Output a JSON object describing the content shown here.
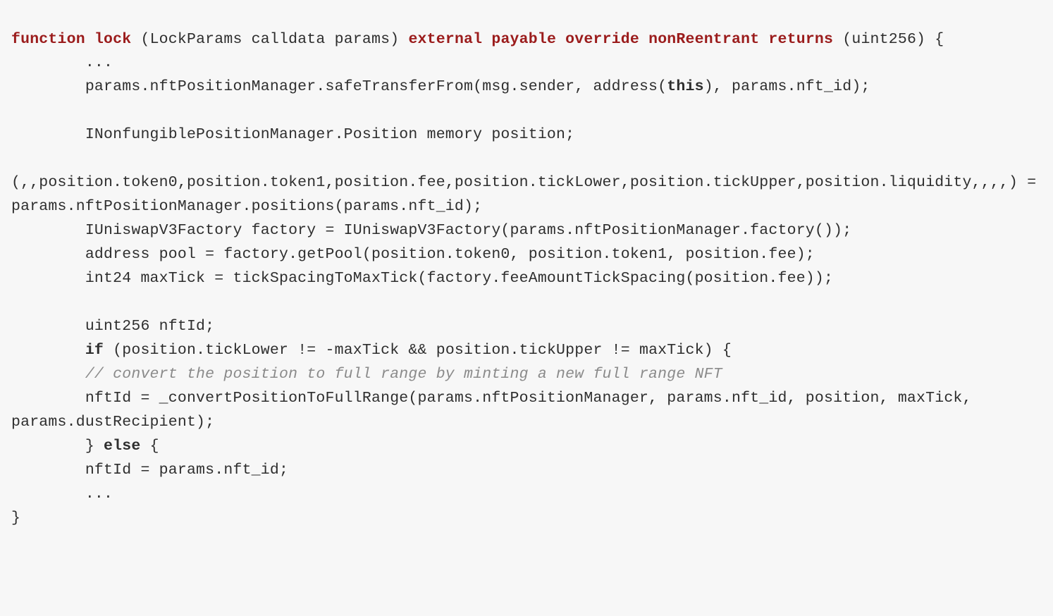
{
  "code": {
    "line1_kw_function": "function",
    "line1_fn_lock": "lock",
    "line1_params": " (LockParams calldata params) ",
    "line1_kw_modifiers": "external payable override nonReentrant returns",
    "line1_tail": " (uint256) {",
    "line2": "        ...",
    "line3_a": "        params.nftPositionManager.safeTransferFrom(msg.sender, address(",
    "line3_this": "this",
    "line3_b": "), params.nft_id);",
    "line4": "",
    "line5": "        INonfungiblePositionManager.Position memory position;",
    "line6": "",
    "line7": "(,,position.token0,position.token1,position.fee,position.tickLower,position.tickUpper,position.liquidity,,,,) = params.nftPositionManager.positions(params.nft_id);",
    "line8": "        IUniswapV3Factory factory = IUniswapV3Factory(params.nftPositionManager.factory());",
    "line9": "        address pool = factory.getPool(position.token0, position.token1, position.fee);",
    "line10": "        int24 maxTick = tickSpacingToMaxTick(factory.feeAmountTickSpacing(position.fee));",
    "line11": "",
    "line12": "        uint256 nftId;",
    "line13_indent": "        ",
    "line13_if": "if",
    "line13_cond": " (position.tickLower != -maxTick && position.tickUpper != maxTick) {",
    "line14_indent": "        ",
    "line14_comment": "// convert the position to full range by minting a new full range NFT",
    "line15": "        nftId = _convertPositionToFullRange(params.nftPositionManager, params.nft_id, position, maxTick, params.dustRecipient);",
    "line16_indent": "        } ",
    "line16_else": "else",
    "line16_tail": " {",
    "line17": "        nftId = params.nft_id;",
    "line18": "        ...",
    "line19": "}"
  }
}
